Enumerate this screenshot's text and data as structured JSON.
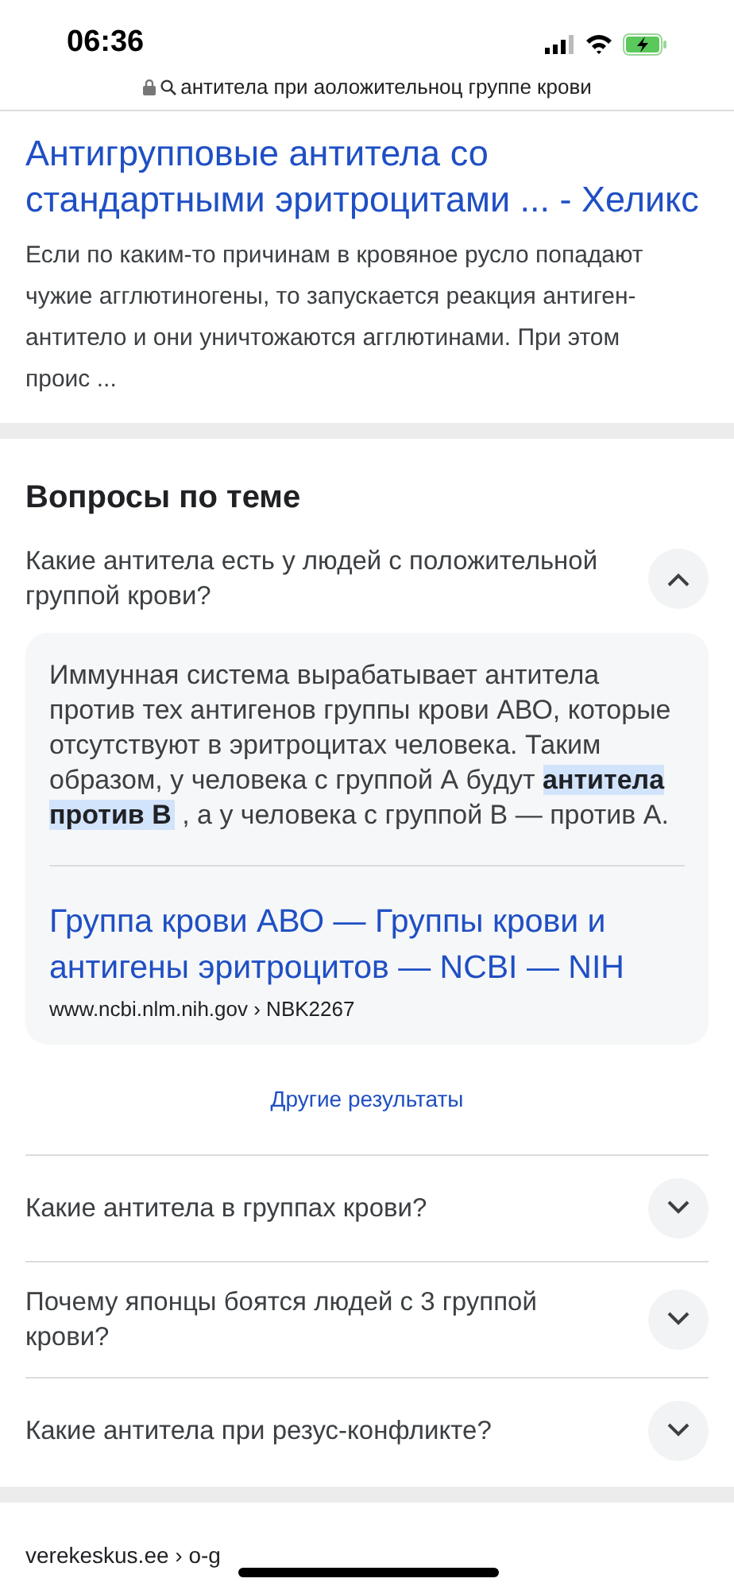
{
  "status_bar": {
    "time": "06:36",
    "charging": true
  },
  "address_bar": {
    "query": "антитела при аоложительноц группе крови"
  },
  "result": {
    "title": "Антигрупповые антитела со стандартными эритроцитами ... - Хеликс",
    "snippet": "Если по каким-то причинам в кровяное русло попадают чужие агглютиногены, то запускается реакция антиген-антитело и они уничтожаются агглютинами. При этом проис ..."
  },
  "related_questions": {
    "heading": "Вопросы по теме",
    "items": [
      {
        "question": "Какие антитела есть у людей с положительной группой крови?",
        "expanded": true,
        "answer": {
          "text": "Иммунная система вырабатывает антитела против тех антигенов группы крови АВО, которые отсутствуют в эритроцитах человека. Таким образом, у человека с группой А будут",
          "highlight": "антитела против В",
          "text_after": ", а у человека с группой В — против А.",
          "link_title": "Группа крови АВО — Группы крови и антигены эритроцитов — NCBI — NIH",
          "source": "www.ncbi.nlm.nih.gov › NBK2267"
        }
      },
      {
        "question": "Какие антитела в группах крови?",
        "expanded": false
      },
      {
        "question": "Почему японцы боятся людей с 3 группой крови?",
        "expanded": false
      },
      {
        "question": "Какие антитела при резус-конфликте?",
        "expanded": false
      }
    ],
    "more_link": "Другие результаты"
  },
  "next_result": {
    "source": "verekeskus.ee › o-g"
  }
}
